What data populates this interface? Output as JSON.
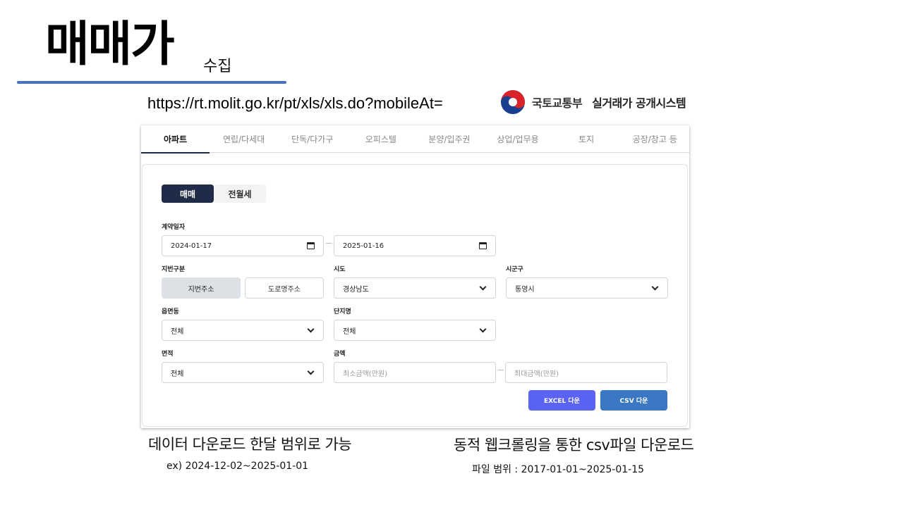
{
  "slide": {
    "title": "매매가",
    "subtitle": "수집",
    "url": "https://rt.molit.go.kr/pt/xls/xls.do?mobileAt=",
    "logo": {
      "ministry": "국토교통부",
      "system": "실거래가 공개시스템"
    }
  },
  "tabs": [
    {
      "label": "아파트"
    },
    {
      "label": "연립/다세대"
    },
    {
      "label": "단독/다가구"
    },
    {
      "label": "오피스텔"
    },
    {
      "label": "분양/입주권"
    },
    {
      "label": "상업/업무용"
    },
    {
      "label": "토지"
    },
    {
      "label": "공장/창고 등"
    }
  ],
  "segment": {
    "active": "매매",
    "inactive": "전월세"
  },
  "form": {
    "contract_date_label": "계약일자",
    "date_from": "2024-01-17",
    "date_to": "2025-01-16",
    "address_type_label": "지번구분",
    "address_lot": "지번주소",
    "address_road": "도로명주소",
    "sido_label": "시도",
    "sido_value": "경상남도",
    "sigungu_label": "시군구",
    "sigungu_value": "통영시",
    "eupmyeondong_label": "읍면동",
    "eupmyeondong_value": "전체",
    "complex_label": "단지명",
    "complex_value": "전체",
    "area_label": "면적",
    "area_value": "전체",
    "price_label": "금액",
    "price_min_placeholder": "최소금액(만원)",
    "price_max_placeholder": "최대금액(만원)"
  },
  "buttons": {
    "excel": "EXCEL 다운",
    "csv": "CSV 다운"
  },
  "notes": {
    "left_main": "데이터 다운로드 한달 범위로 가능",
    "left_sub": "ex) 2024-12-02~2025-01-01",
    "right_main": "동적 웹크롤링을 통한 csv파일 다운로드",
    "right_sub": "파일 범위 : 2017-01-01~2025-01-15"
  },
  "colors": {
    "title_rule": "#4472c4",
    "segment_active": "#1f2b47",
    "excel_button": "#5b63f5",
    "csv_button": "#3a78c3"
  }
}
